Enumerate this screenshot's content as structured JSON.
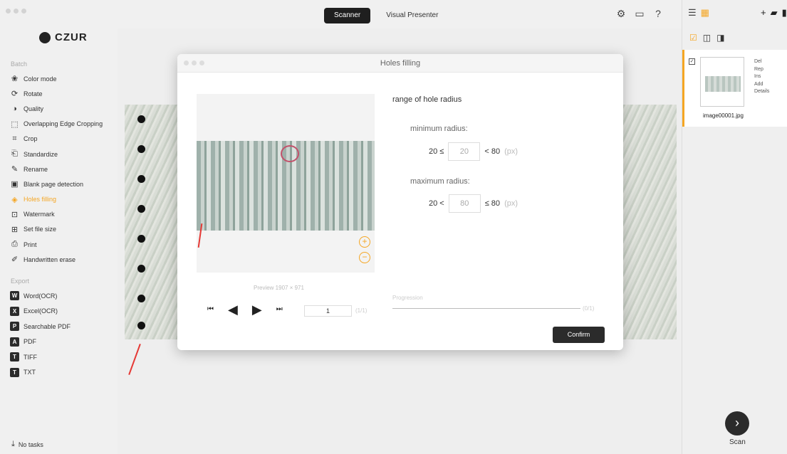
{
  "topbar": {
    "tabs": [
      {
        "label": "Scanner",
        "active": true
      },
      {
        "label": "Visual Presenter",
        "active": false
      }
    ],
    "icons": [
      "gear-icon",
      "chat-icon",
      "help-icon"
    ]
  },
  "sidebar": {
    "logo_text": "CZUR",
    "batch_label": "Batch",
    "items": [
      {
        "label": "Color mode",
        "icon": "color-mode-icon"
      },
      {
        "label": "Rotate",
        "icon": "rotate-icon"
      },
      {
        "label": "Quality",
        "icon": "quality-icon"
      },
      {
        "label": "Overlapping Edge Cropping",
        "icon": "edge-crop-icon"
      },
      {
        "label": "Crop",
        "icon": "crop-icon"
      },
      {
        "label": "Standardize",
        "icon": "standardize-icon"
      },
      {
        "label": "Rename",
        "icon": "rename-icon"
      },
      {
        "label": "Blank page detection",
        "icon": "blank-page-icon"
      },
      {
        "label": "Holes filling",
        "icon": "holes-filling-icon",
        "active": true
      },
      {
        "label": "Watermark",
        "icon": "watermark-icon"
      },
      {
        "label": "Set file size",
        "icon": "file-size-icon"
      },
      {
        "label": "Print",
        "icon": "print-icon"
      },
      {
        "label": "Handwritten erase",
        "icon": "erase-icon"
      }
    ],
    "export_label": "Export",
    "exports": [
      {
        "label": "Word(OCR)",
        "badge": "W"
      },
      {
        "label": "Excel(OCR)",
        "badge": "X"
      },
      {
        "label": "Searchable PDF",
        "badge": "P"
      },
      {
        "label": "PDF",
        "badge": "A"
      },
      {
        "label": "TIFF",
        "badge": "T"
      },
      {
        "label": "TXT",
        "badge": "T"
      }
    ],
    "no_tasks": "No tasks"
  },
  "modal": {
    "title": "Holes filling",
    "range_title": "range of hole radius",
    "min_label": "minimum radius:",
    "min_prefix": "20 ≤",
    "min_value": "20",
    "min_suffix": "< 80",
    "max_label": "maximum radius:",
    "max_prefix": "20 <",
    "max_value": "80",
    "max_suffix": "≤ 80",
    "unit": "(px)",
    "preview_caption": "Preview  1907 × 971",
    "page_value": "1",
    "page_total": "(1/1)",
    "progress_label": "Progression",
    "progress_pct": "(0/1)",
    "confirm": "Confirm"
  },
  "right_panel": {
    "file_name": "image00001.jpg",
    "context_menu": [
      "Del",
      "Rep",
      "Ins",
      "Add",
      "Details"
    ],
    "scan_label": "Scan"
  },
  "colors": {
    "accent": "#f5a623",
    "dark": "#2b2b2b",
    "arrow": "#e53935"
  }
}
